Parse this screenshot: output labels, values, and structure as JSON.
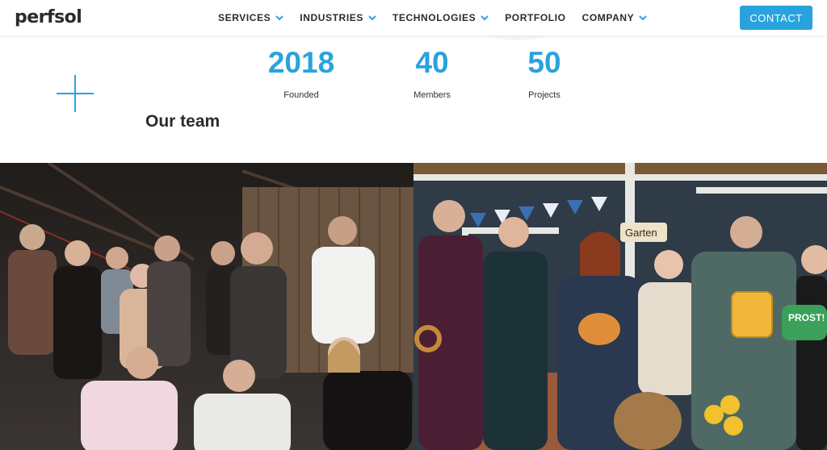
{
  "brand": {
    "logo_text": "perfsol",
    "accent_color": "#29a3dd"
  },
  "nav": {
    "items": [
      {
        "label": "SERVICES",
        "has_dropdown": true
      },
      {
        "label": "INDUSTRIES",
        "has_dropdown": true
      },
      {
        "label": "TECHNOLOGIES",
        "has_dropdown": true
      },
      {
        "label": "PORTFOLIO",
        "has_dropdown": false
      },
      {
        "label": "COMPANY",
        "has_dropdown": true
      }
    ],
    "contact_label": "CONTACT"
  },
  "stats": [
    {
      "value": "2018",
      "label": "Founded"
    },
    {
      "value": "40",
      "label": "Members"
    },
    {
      "value": "50",
      "label": "Projects"
    }
  ],
  "team": {
    "title": "Our team",
    "photos": [
      {
        "name": "team-photo-warehouse",
        "scene": "group of colleagues in a dark wooden hall"
      },
      {
        "name": "team-photo-oktoberfest",
        "scene": "colleagues at an Oktoberfest-themed booth with props"
      }
    ],
    "props_text": {
      "sign_garden": "Garten",
      "sign_prost": "PROST!"
    }
  }
}
